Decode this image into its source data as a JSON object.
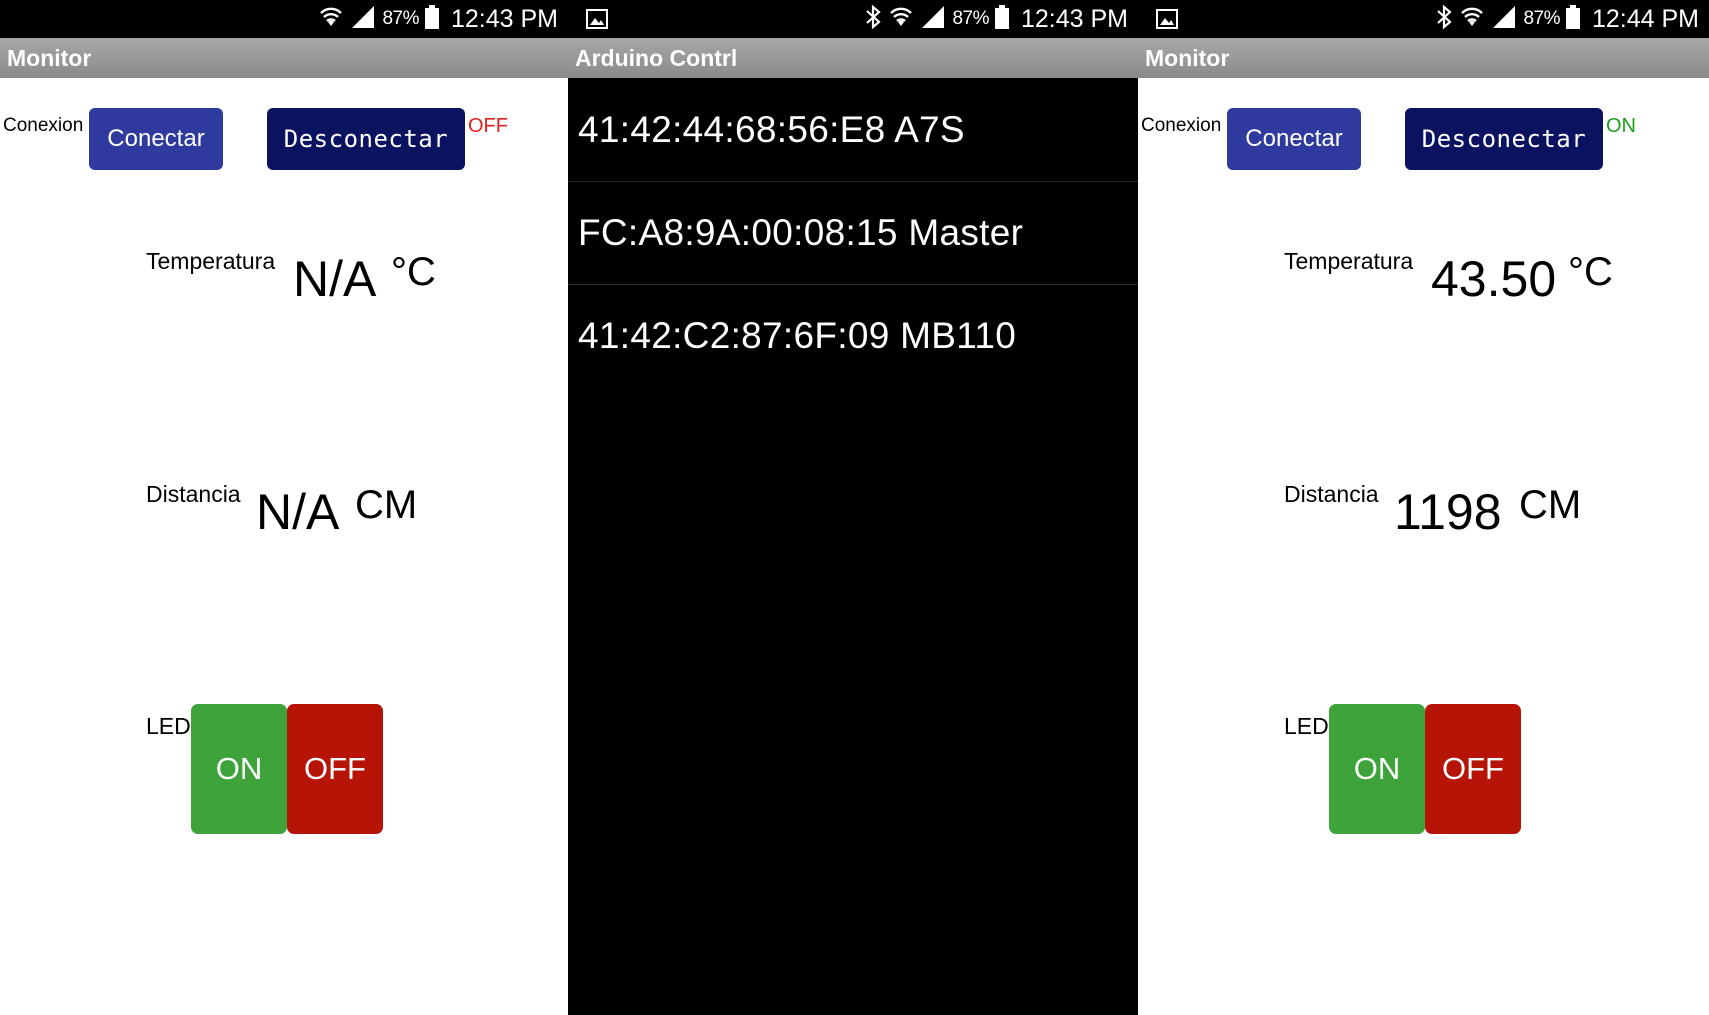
{
  "panels": [
    {
      "status": {
        "battery": "87%",
        "time": "12:43 PM"
      },
      "title": "Monitor",
      "conexion_label": "Conexion",
      "conectar_label": "Conectar",
      "desconectar_label": "Desconectar",
      "connection_state": "OFF",
      "temperatura_label": "Temperatura",
      "temperatura_value": "N/A",
      "temperatura_unit": "°C",
      "distancia_label": "Distancia",
      "distancia_value": "N/A",
      "distancia_unit": "CM",
      "led_label": "LED",
      "led_on_label": "ON",
      "led_off_label": "OFF"
    },
    {
      "status": {
        "battery": "87%",
        "time": "12:43 PM"
      },
      "title": "Arduino Contrl",
      "devices": [
        "41:42:44:68:56:E8 A7S",
        "FC:A8:9A:00:08:15 Master",
        "41:42:C2:87:6F:09 MB110"
      ]
    },
    {
      "status": {
        "battery": "87%",
        "time": "12:44 PM"
      },
      "title": "Monitor",
      "conexion_label": "Conexion",
      "conectar_label": "Conectar",
      "desconectar_label": "Desconectar",
      "connection_state": "ON",
      "temperatura_label": "Temperatura",
      "temperatura_value": "43.50",
      "temperatura_unit": "°C",
      "distancia_label": "Distancia",
      "distancia_value": "1198",
      "distancia_unit": "CM",
      "led_label": "LED",
      "led_on_label": "ON",
      "led_off_label": "OFF"
    }
  ],
  "colors": {
    "conectar_bg": "#2f3a9e",
    "desconectar_bg": "#0b1260",
    "led_on_bg": "#3da33a",
    "led_off_bg": "#b71408",
    "state_off": "#e02020",
    "state_on": "#1ea01e",
    "titlebar_bg": "#999999"
  },
  "icons": {
    "statusbar": [
      "gallery-notification-icon",
      "bluetooth-icon",
      "wifi-icon",
      "signal-icon",
      "battery-icon"
    ]
  }
}
